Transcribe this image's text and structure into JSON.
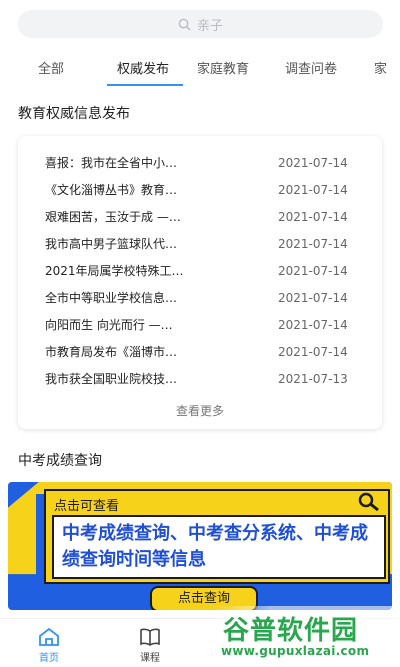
{
  "search": {
    "placeholder": "亲子"
  },
  "tabs": [
    {
      "label": "全部",
      "active": false
    },
    {
      "label": "权威发布",
      "active": true
    },
    {
      "label": "家庭教育",
      "active": false
    },
    {
      "label": "调查问卷",
      "active": false
    },
    {
      "label": "家",
      "active": false
    }
  ],
  "section1": {
    "title": "教育权威信息发布",
    "items": [
      {
        "title": "喜报：我市在全省中小…",
        "date": "2021-07-14"
      },
      {
        "title": "《文化淄博丛书》教育…",
        "date": "2021-07-14"
      },
      {
        "title": "艰难困苦，玉汝于成 —…",
        "date": "2021-07-14"
      },
      {
        "title": "我市高中男子篮球队代…",
        "date": "2021-07-14"
      },
      {
        "title": "2021年局属学校特殊工…",
        "date": "2021-07-14"
      },
      {
        "title": "全市中等职业学校信息…",
        "date": "2021-07-14"
      },
      {
        "title": "向阳而生 向光而行 —…",
        "date": "2021-07-14"
      },
      {
        "title": "市教育局发布《淄博市…",
        "date": "2021-07-14"
      },
      {
        "title": "我市获全国职业院校技…",
        "date": "2021-07-13"
      }
    ],
    "more_label": "查看更多"
  },
  "section2": {
    "title": "中考成绩查询",
    "banner": {
      "cta": "点击可查看",
      "text": "中考成绩查询、中考查分系统、中考成绩查询时间等信息",
      "button": "点击查询"
    }
  },
  "bottom_nav": [
    {
      "label": "首页",
      "icon": "home-icon",
      "active": true
    },
    {
      "label": "课程",
      "icon": "book-icon",
      "active": false
    }
  ],
  "watermark": {
    "main": "谷普软件园",
    "sub": "www.gupuxlazai.com"
  },
  "colors": {
    "accent": "#2f93f5",
    "banner_yellow": "#f7d21b",
    "banner_blue": "#1f5fe0",
    "watermark_green": "#2aa64f"
  }
}
